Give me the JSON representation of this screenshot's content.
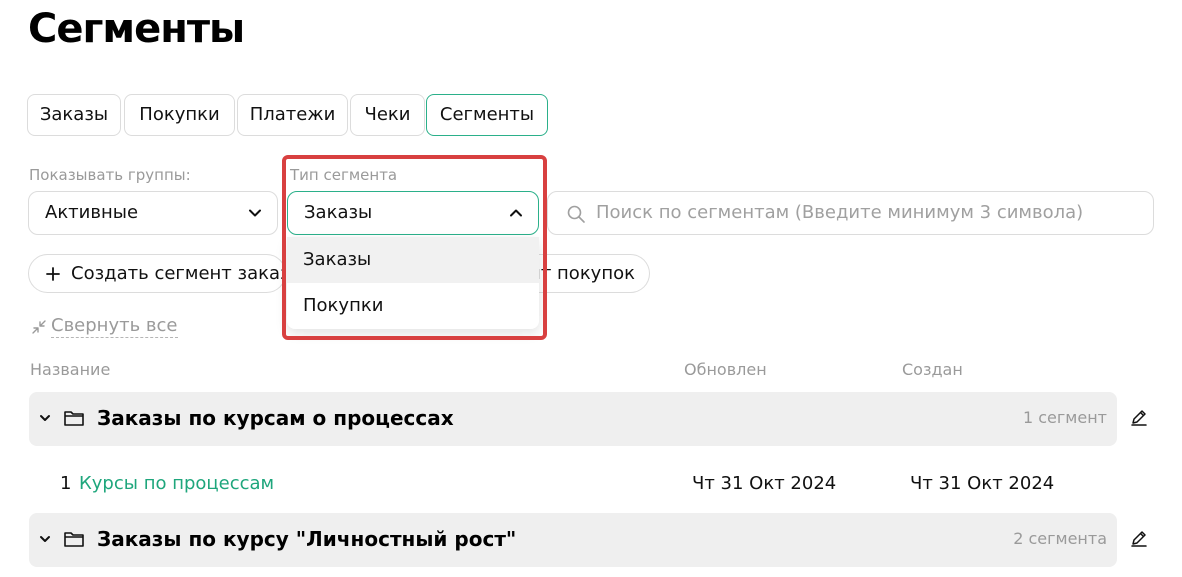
{
  "page": {
    "title": "Сегменты"
  },
  "tabs": [
    "Заказы",
    "Покупки",
    "Платежи",
    "Чеки",
    "Сегменты"
  ],
  "active_tab": "Сегменты",
  "filters": {
    "groups_label": "Показывать группы:",
    "groups_value": "Активные",
    "type_label": "Тип сегмента",
    "type_value": "Заказы",
    "type_options": [
      "Заказы",
      "Покупки"
    ],
    "search_placeholder": "Поиск по сегментам (Введите минимум 3 символа)"
  },
  "actions": {
    "create_order_segment": "Создать сегмент заказов",
    "create_purchase_segment": "Создать сегмент покупок",
    "collapse_all": "Свернуть все"
  },
  "table": {
    "headers": {
      "name": "Название",
      "updated": "Обновлен",
      "created": "Создан"
    },
    "groups": [
      {
        "title": "Заказы по курсам о процессах",
        "count": "1 сегмент",
        "rows": [
          {
            "num": "1",
            "name": "Курсы по процессам",
            "updated": "Чт 31 Окт 2024",
            "created": "Чт 31 Окт 2024"
          }
        ]
      },
      {
        "title": "Заказы по курсу \"Личностный рост\"",
        "count": "2 сегмента",
        "rows": []
      }
    ]
  },
  "colors": {
    "accent": "#2bb08a",
    "link": "#1ea67c",
    "highlight": "#d84040"
  },
  "icons": [
    "chevron-down-icon",
    "chevron-up-icon",
    "search-icon",
    "plus-icon",
    "collapse-icon",
    "folder-icon",
    "pencil-icon"
  ]
}
